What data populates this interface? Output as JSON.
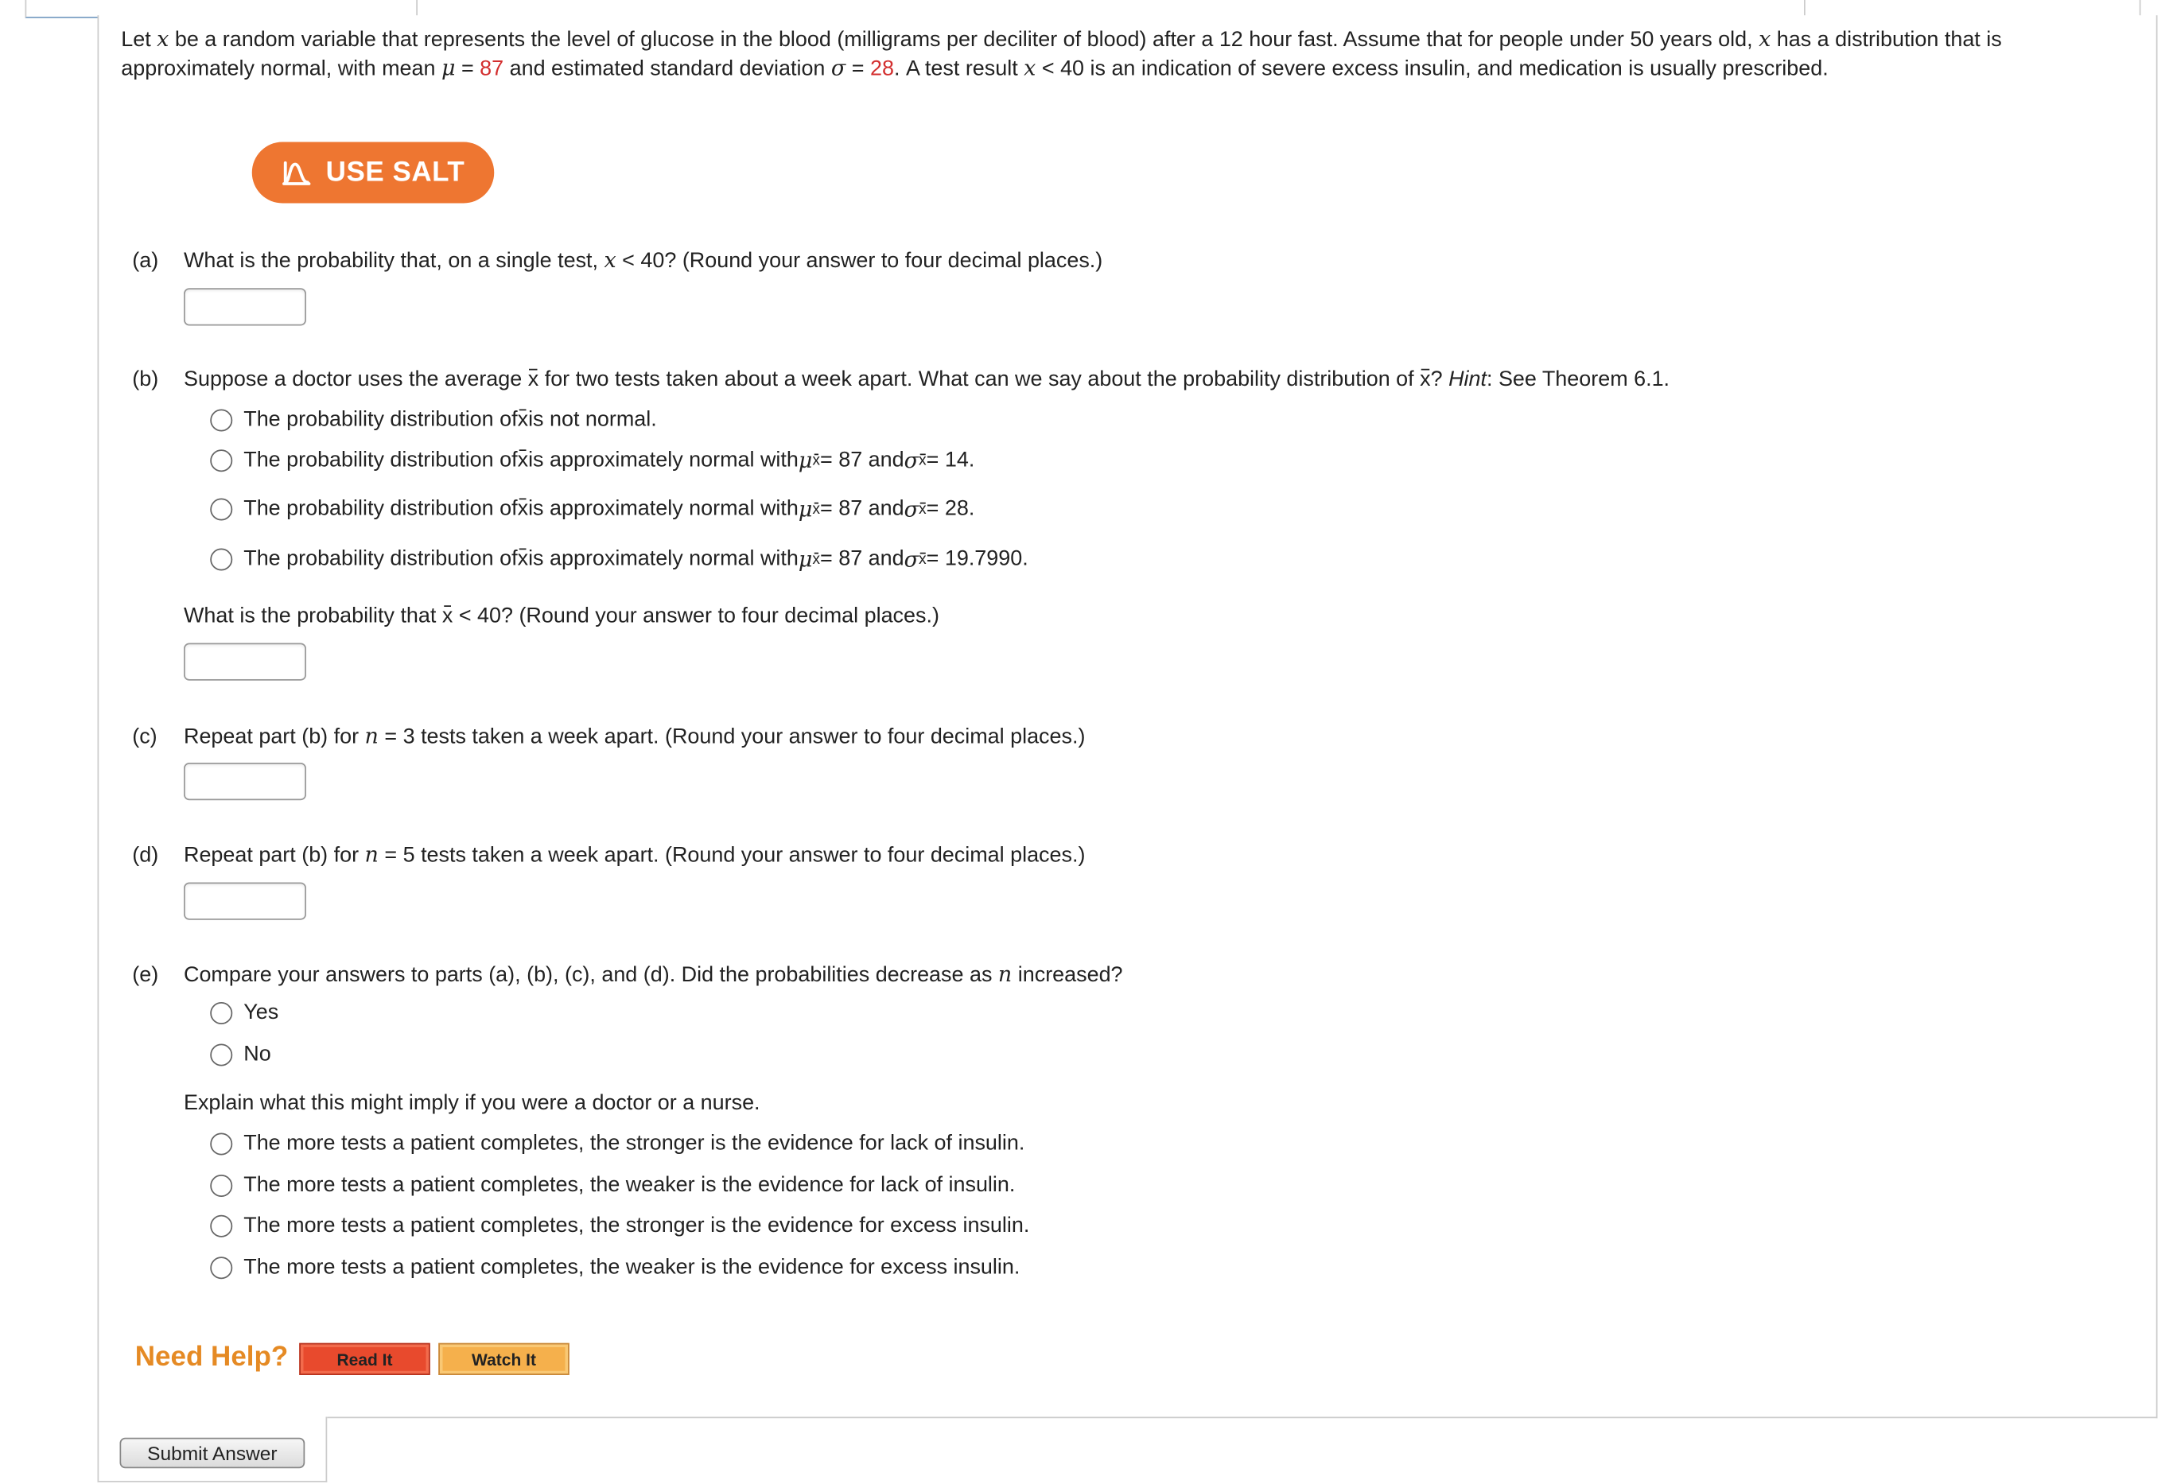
{
  "intro": {
    "t1": "Let ",
    "x": "x",
    "t2": " be a random variable that represents the level of glucose in the blood (milligrams per deciliter of blood) after a 12 hour fast. Assume that for people under 50 years old, ",
    "t3": " has a distribution that is approximately normal, with mean ",
    "mu": "μ",
    "eq": " = ",
    "mean": "87",
    "t4": " and estimated standard deviation ",
    "sigma": "σ",
    "sd": "28",
    "t5": ". A test result ",
    "t6": " < 40 is an indication of severe excess insulin, and medication is usually prescribed."
  },
  "salt_button": "USE SALT",
  "part_a": {
    "label": "(a)",
    "q1": "What is the probability that, on a single test, ",
    "x": "x",
    "q2": " < 40? (Round your answer to four decimal places.)"
  },
  "part_b": {
    "label": "(b)",
    "q1": "Suppose a doctor uses the average ",
    "x": "x",
    "q2": " for two tests taken about a week apart. What can we say about the probability distribution of ",
    "q3": "? ",
    "hint": "Hint",
    "q4": ": See Theorem 6.1.",
    "options": [
      {
        "pre": "The probability distribution of ",
        "post": " is not normal."
      },
      {
        "pre": "The probability distribution of ",
        "post": " is approximately normal with ",
        "mu": "μ",
        "mid": " = 87 and ",
        "sigma": "σ",
        "end": " = 14."
      },
      {
        "pre": "The probability distribution of ",
        "post": " is approximately normal with ",
        "mu": "μ",
        "mid": " = 87 and ",
        "sigma": "σ",
        "end": " = 28."
      },
      {
        "pre": "The probability distribution of ",
        "post": " is approximately normal with ",
        "mu": "μ",
        "mid": " = 87 and ",
        "sigma": "σ",
        "end": " = 19.7990."
      }
    ],
    "sub_x": "x",
    "followup1": "What is the probability that ",
    "followup2": " < 40? (Round your answer to four decimal places.)"
  },
  "part_c": {
    "label": "(c)",
    "q1": "Repeat part (b) for ",
    "n": "n",
    "q2": " = 3 tests taken a week apart. (Round your answer to four decimal places.)"
  },
  "part_d": {
    "label": "(d)",
    "q1": "Repeat part (b) for ",
    "n": "n",
    "q2": " = 5 tests taken a week apart. (Round your answer to four decimal places.)"
  },
  "part_e": {
    "label": "(e)",
    "q1": "Compare your answers to parts (a), (b), (c), and (d). Did the probabilities decrease as ",
    "n": "n",
    "q2": " increased?",
    "yes": "Yes",
    "no": "No",
    "explain": "Explain what this might imply if you were a doctor or a nurse.",
    "options": [
      "The more tests a patient completes, the stronger is the evidence for lack of insulin.",
      "The more tests a patient completes, the weaker is the evidence for lack of insulin.",
      "The more tests a patient completes, the stronger is the evidence for excess insulin.",
      "The more tests a patient completes, the weaker is the evidence for excess insulin."
    ]
  },
  "help": {
    "label": "Need Help?",
    "read_it": "Read It",
    "watch_it": "Watch It"
  },
  "submit": "Submit Answer",
  "colors": {
    "accent_red": "#d32f2f",
    "salt_orange": "#ee7631",
    "need_help": "#e58a24"
  }
}
